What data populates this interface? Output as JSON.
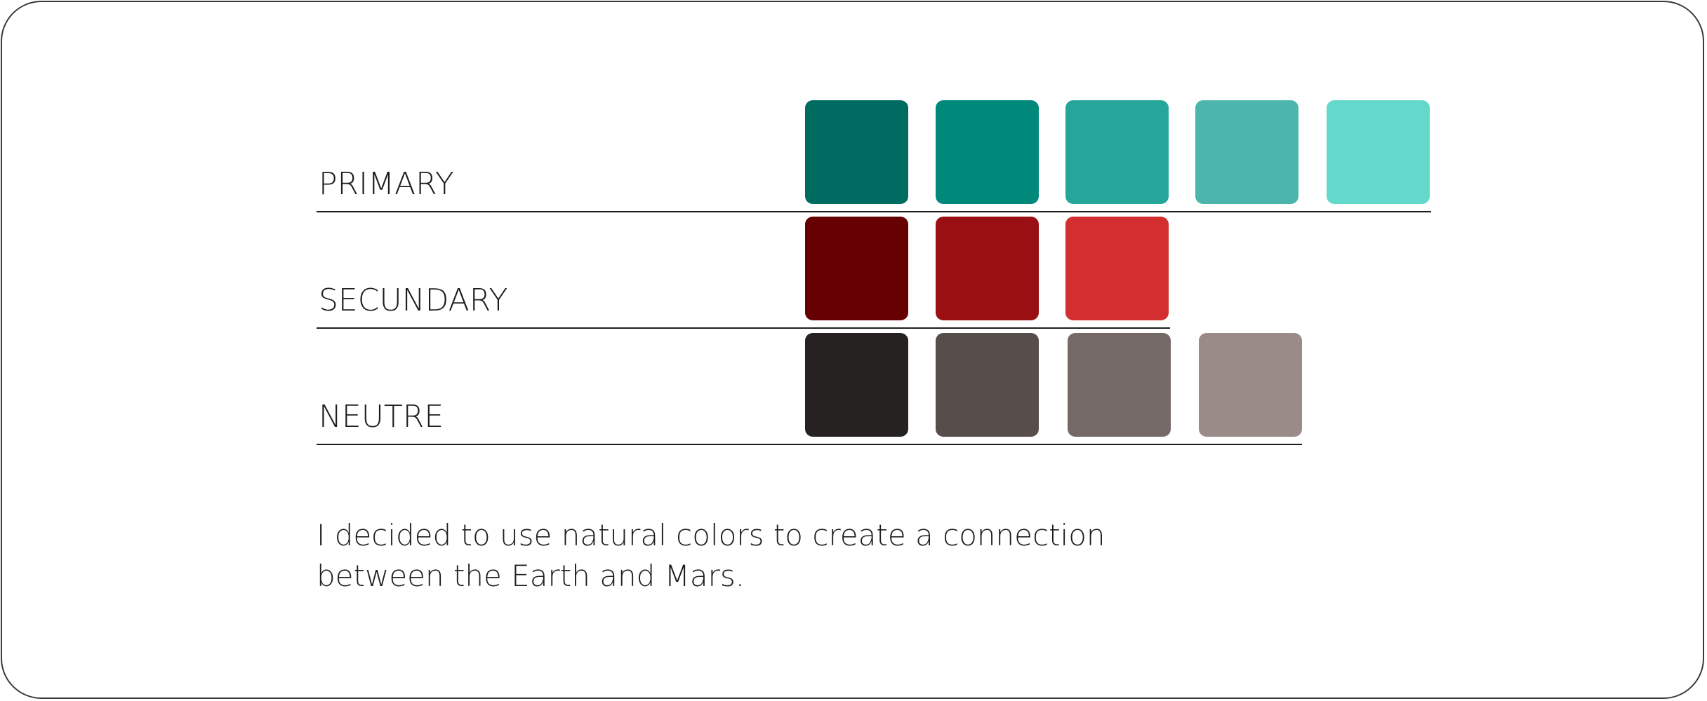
{
  "palette": {
    "rows": [
      {
        "label": "PRIMARY",
        "swatches": [
          {
            "color": "#006b61"
          },
          {
            "color": "#00897b"
          },
          {
            "color": "#26a69a"
          },
          {
            "color": "#4db6ac"
          },
          {
            "color": "#64d8cb"
          }
        ]
      },
      {
        "label": "SECUNDARY",
        "swatches": [
          {
            "color": "#670000"
          },
          {
            "color": "#990f12"
          },
          {
            "color": "#d32f30"
          }
        ]
      },
      {
        "label": "NEUTRE",
        "swatches": [
          {
            "color": "#252221"
          },
          {
            "color": "#574e4b"
          },
          {
            "color": "#756968"
          },
          {
            "color": "#9a8b88"
          }
        ]
      }
    ]
  },
  "caption": {
    "line1": "I decided to use natural colors to create a connection",
    "line2": "between the Earth and Mars."
  }
}
